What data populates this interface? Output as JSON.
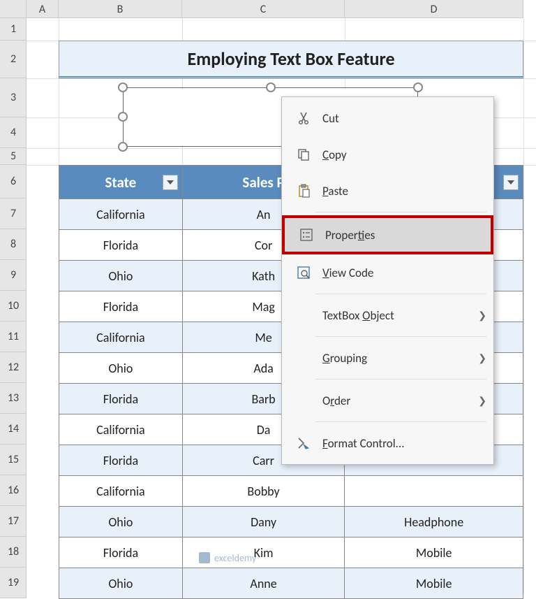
{
  "columns": [
    "A",
    "B",
    "C",
    "D"
  ],
  "rows": [
    "1",
    "2",
    "3",
    "4",
    "5",
    "6",
    "7",
    "8",
    "9",
    "10",
    "11",
    "12",
    "13",
    "14",
    "15",
    "16",
    "17",
    "18",
    "19"
  ],
  "title": "Employing Text Box Feature",
  "table": {
    "headers": [
      "State",
      "Sales P",
      ""
    ],
    "rows": [
      [
        "California",
        "An",
        ""
      ],
      [
        "Florida",
        "Cor",
        ""
      ],
      [
        "Ohio",
        "Kath",
        ""
      ],
      [
        "Florida",
        "Mag",
        ""
      ],
      [
        "California",
        "Me",
        ""
      ],
      [
        "Ohio",
        "Ada",
        ""
      ],
      [
        "Florida",
        "Barb",
        ""
      ],
      [
        "California",
        "Da",
        ""
      ],
      [
        "Florida",
        "Carr",
        ""
      ],
      [
        "California",
        "Bobby",
        ""
      ],
      [
        "Ohio",
        "Dany",
        "Headphone"
      ],
      [
        "Florida",
        "Kim",
        "Mobile"
      ],
      [
        "Ohio",
        "Anne",
        "Mobile"
      ]
    ]
  },
  "menu": {
    "cut": "Cut",
    "copy": "Copy",
    "paste": "Paste",
    "properties": "Properties",
    "viewcode": "View Code",
    "tbobject": "TextBox Object",
    "grouping": "Grouping",
    "order": "Order",
    "format": "Format Control..."
  },
  "watermark": "exceldemy"
}
